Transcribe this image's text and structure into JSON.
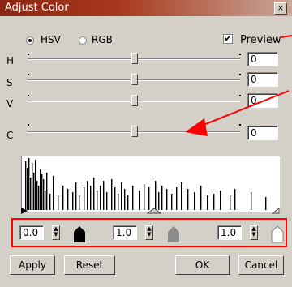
{
  "window": {
    "title": "Adjust Color",
    "close_label": "×"
  },
  "mode": {
    "hsv_label": "HSV",
    "rgb_label": "RGB",
    "selected": "HSV"
  },
  "preview": {
    "label": "Preview",
    "checked": true
  },
  "sliders": [
    {
      "label": "H",
      "value": "0"
    },
    {
      "label": "S",
      "value": "0"
    },
    {
      "label": "V",
      "value": "0"
    },
    {
      "label": "C",
      "value": "0"
    }
  ],
  "levels": {
    "black": "0.0",
    "gray": "1.0",
    "white": "1.0"
  },
  "buttons": {
    "apply": "Apply",
    "reset": "Reset",
    "ok": "OK",
    "cancel": "Cancel"
  },
  "colors": {
    "accent_red": "#ff0000",
    "title_bar": "#8a2512",
    "face": "#d4d0c8"
  }
}
